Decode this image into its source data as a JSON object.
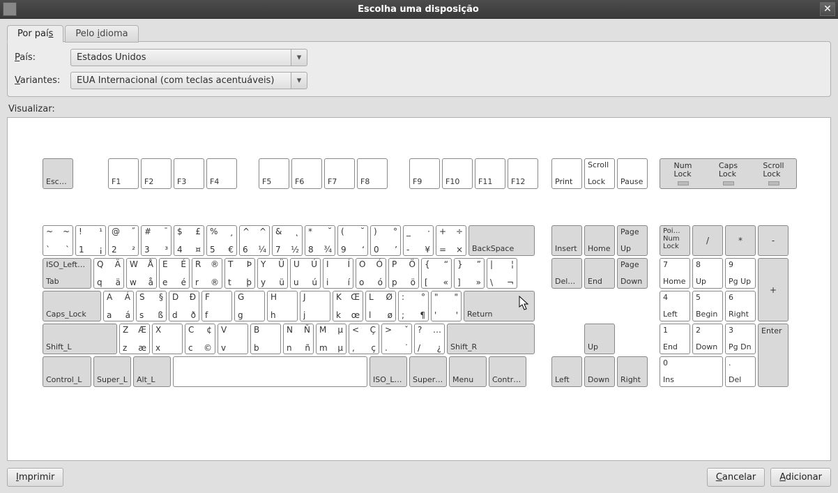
{
  "window": {
    "title": "Escolha uma disposição"
  },
  "tabs": {
    "country": {
      "pre": "Por paí",
      "u": "s"
    },
    "language": {
      "pre": "Pelo ",
      "u": "i",
      "post": "dioma"
    }
  },
  "form": {
    "country_label": {
      "u": "P",
      "post": "aís:"
    },
    "country_value": "Estados Unidos",
    "variant_label": {
      "u": "V",
      "post": "ariantes:"
    },
    "variant_value": "EUA Internacional (com teclas acentuáveis)"
  },
  "preview_label": "Visualizar:",
  "buttons": {
    "print": {
      "u": "I",
      "post": "mprimir"
    },
    "cancel": {
      "u": "C",
      "post": "ancelar"
    },
    "add": {
      "u": "A",
      "post": "dicionar"
    }
  },
  "locks": {
    "num": "Num Lock",
    "caps": "Caps Lock",
    "scroll": "Scroll Lock"
  },
  "row_fn": {
    "esc": "Esc…",
    "f": [
      "F1",
      "F2",
      "F3",
      "F4",
      "F5",
      "F6",
      "F7",
      "F8",
      "F9",
      "F10",
      "F11",
      "F12"
    ],
    "print": "Print",
    "scroll_top": "Scroll",
    "scroll_bot": "Lock",
    "pause": "Pause"
  },
  "row_num": {
    "tilde": {
      "tl": "~",
      "tr": "~",
      "bl": "`",
      "br": "`"
    },
    "d1": {
      "tl": "!",
      "tr": "¹",
      "bl": "1",
      "br": "¡"
    },
    "d2": {
      "tl": "@",
      "tr": "˝",
      "bl": "2",
      "br": "²"
    },
    "d3": {
      "tl": "#",
      "tr": "¯",
      "bl": "3",
      "br": "³"
    },
    "d4": {
      "tl": "$",
      "tr": "£",
      "bl": "4",
      "br": "¤"
    },
    "d5": {
      "tl": "%",
      "tr": "¸",
      "bl": "5",
      "br": "€"
    },
    "d6": {
      "tl": "^",
      "tr": "^",
      "bl": "6",
      "br": "¼"
    },
    "d7": {
      "tl": "&",
      "tr": "˛",
      "bl": "7",
      "br": "½"
    },
    "d8": {
      "tl": "*",
      "tr": "˘",
      "bl": "8",
      "br": "¾"
    },
    "d9": {
      "tl": "(",
      "tr": "˘",
      "bl": "9",
      "br": "‘"
    },
    "d0": {
      "tl": ")",
      "tr": "°",
      "bl": "0",
      "br": "’"
    },
    "minus": {
      "tl": "_",
      "tr": "·",
      "bl": "-",
      "br": "¥"
    },
    "equal": {
      "tl": "+",
      "tr": "÷",
      "bl": "=",
      "br": "×"
    },
    "backspace": "BackSpace"
  },
  "row_q": {
    "tab_top": "ISO_Left…",
    "tab_bot": "Tab",
    "q": {
      "tl": "Q",
      "tr": "Ä",
      "bl": "q",
      "br": "ä"
    },
    "w": {
      "tl": "W",
      "tr": "Å",
      "bl": "w",
      "br": "å"
    },
    "e": {
      "tl": "E",
      "tr": "É",
      "bl": "e",
      "br": "é"
    },
    "r": {
      "tl": "R",
      "tr": "®",
      "bl": "r",
      "br": "®"
    },
    "t": {
      "tl": "T",
      "tr": "Þ",
      "bl": "t",
      "br": "þ"
    },
    "y": {
      "tl": "Y",
      "tr": "Ü",
      "bl": "y",
      "br": "ü"
    },
    "u": {
      "tl": "U",
      "tr": "Ú",
      "bl": "u",
      "br": "ú"
    },
    "i": {
      "tl": "I",
      "tr": "Í",
      "bl": "i",
      "br": "í"
    },
    "o": {
      "tl": "O",
      "tr": "Ó",
      "bl": "o",
      "br": "ó"
    },
    "p": {
      "tl": "P",
      "tr": "Ö",
      "bl": "p",
      "br": "ö"
    },
    "lb": {
      "tl": "{",
      "tr": "“",
      "bl": "[",
      "br": "«"
    },
    "rb": {
      "tl": "}",
      "tr": "”",
      "bl": "]",
      "br": "»"
    },
    "bs": {
      "tl": "|",
      "tr": "¦",
      "bl": "\\",
      "br": "¬"
    }
  },
  "row_a": {
    "caps": "Caps_Lock",
    "a": {
      "tl": "A",
      "tr": "Á",
      "bl": "a",
      "br": "á"
    },
    "s": {
      "tl": "S",
      "tr": "§",
      "bl": "s",
      "br": "ß"
    },
    "d": {
      "tl": "D",
      "tr": "Ð",
      "bl": "d",
      "br": "ð"
    },
    "f": {
      "tl": "F",
      "tr": "",
      "bl": "f",
      "br": ""
    },
    "g": {
      "tl": "G",
      "tr": "",
      "bl": "g",
      "br": ""
    },
    "h": {
      "tl": "H",
      "tr": "",
      "bl": "h",
      "br": ""
    },
    "j": {
      "tl": "J",
      "tr": "",
      "bl": "j",
      "br": ""
    },
    "k": {
      "tl": "K",
      "tr": "Œ",
      "bl": "k",
      "br": "œ"
    },
    "l": {
      "tl": "L",
      "tr": "Ø",
      "bl": "l",
      "br": "ø"
    },
    "semi": {
      "tl": ":",
      "tr": "°",
      "bl": ";",
      "br": "¶"
    },
    "quote": {
      "tl": "\"",
      "tr": "\"",
      "bl": "'",
      "br": "'"
    },
    "return": "Return"
  },
  "row_z": {
    "shift_l": "Shift_L",
    "z": {
      "tl": "Z",
      "tr": "Æ",
      "bl": "z",
      "br": "æ"
    },
    "x": {
      "tl": "X",
      "tr": "",
      "bl": "x",
      "br": ""
    },
    "c": {
      "tl": "C",
      "tr": "¢",
      "bl": "c",
      "br": "©"
    },
    "v": {
      "tl": "V",
      "tr": "",
      "bl": "v",
      "br": ""
    },
    "b": {
      "tl": "B",
      "tr": "",
      "bl": "b",
      "br": ""
    },
    "n": {
      "tl": "N",
      "tr": "Ñ",
      "bl": "n",
      "br": "ñ"
    },
    "m": {
      "tl": "M",
      "tr": "µ",
      "bl": "m",
      "br": "µ"
    },
    "comma": {
      "tl": "<",
      "tr": "Ç",
      "bl": ",",
      "br": "ç"
    },
    "dot": {
      "tl": ">",
      "tr": "ˇ",
      "bl": ".",
      "br": "˙"
    },
    "slash": {
      "tl": "?",
      "tr": "…",
      "bl": "/",
      "br": "¿"
    },
    "shift_r": "Shift_R"
  },
  "row_ctrl": {
    "ctrl_l": "Control_L",
    "super_l": "Super_L",
    "alt_l": "Alt_L",
    "isol": "ISO_L…",
    "super_r": "Super_R",
    "menu": "Menu",
    "ctrl_r": "Contr…"
  },
  "nav": {
    "insert": "Insert",
    "home": "Home",
    "pgup_top": "Page",
    "pgup_bot": "Up",
    "del": "Del…",
    "end": "End",
    "pgdn_top": "Page",
    "pgdn_bot": "Down",
    "up": "Up",
    "left": "Left",
    "down": "Down",
    "right": "Right"
  },
  "np": {
    "numlock_top": "Poi…",
    "numlock_mid": "Num",
    "numlock_bot": "Lock",
    "div": "/",
    "mul": "*",
    "sub": "-",
    "k7_t": "7",
    "k7_b": "Home",
    "k8_t": "8",
    "k8_b": "Up",
    "k9_t": "9",
    "k9_b": "Pg Up",
    "add": "+",
    "k4_t": "4",
    "k4_b": "Left",
    "k5_t": "5",
    "k5_b": "Begin",
    "k6_t": "6",
    "k6_b": "Right",
    "k1_t": "1",
    "k1_b": "End",
    "k2_t": "2",
    "k2_b": "Down",
    "k3_t": "3",
    "k3_b": "Pg Dn",
    "enter": "Enter",
    "k0_t": "0",
    "k0_b": "Ins",
    "kd_t": ".",
    "kd_b": "Del"
  }
}
